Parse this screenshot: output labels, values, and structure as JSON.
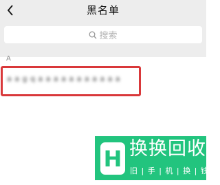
{
  "header": {
    "back_icon": "chevron-left-icon",
    "title": "黑名单"
  },
  "search": {
    "icon": "search-icon",
    "placeholder": "搜索"
  },
  "section": {
    "letter": "A"
  },
  "contacts": [
    {
      "name": "a a g q a a a a a a a a a a a"
    }
  ],
  "highlight_color": "#d9383a",
  "watermark": {
    "title": "换换回收",
    "subtitle": "旧 | 手 | 机 | 换 | 钱",
    "color": "#22c47e"
  }
}
